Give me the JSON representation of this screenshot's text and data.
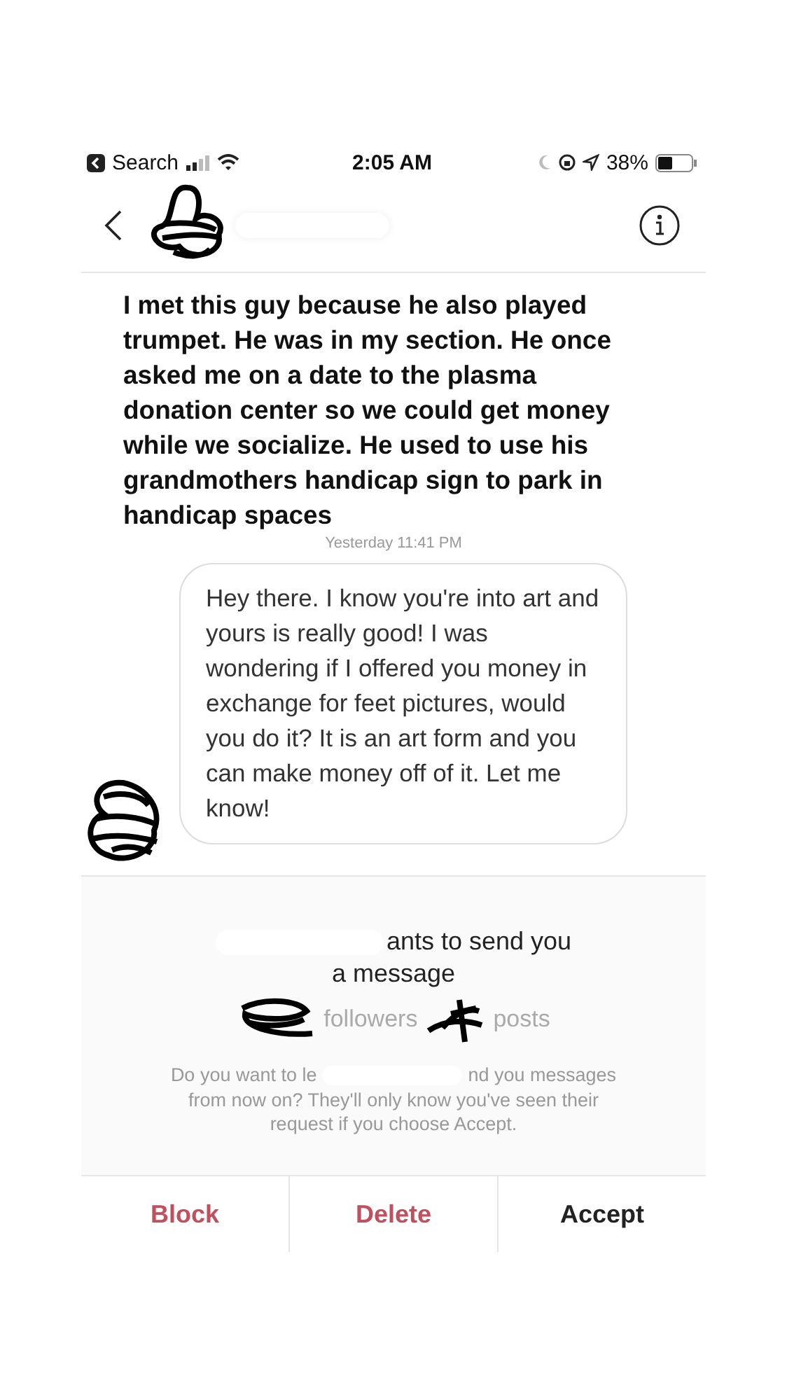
{
  "status_bar": {
    "back_app": "Search",
    "time": "2:05 AM",
    "battery": "38%"
  },
  "caption": "I met this guy because he also played trumpet. He was in my section. He once asked me on a date to the plasma donation center so we could get money while we socialize. He used to use his grandmothers handicap sign to park in handicap spaces",
  "timestamp": "Yesterday 11:41 PM",
  "message": "Hey there. I know you're into art and yours is really good! I was wondering if I offered you money in exchange for feet pictures, would you do it? It is an art form and you can make money off of it. Let me know!",
  "request": {
    "title_lines": [
      "ants to send you",
      "a message"
    ],
    "stats": [
      "followers",
      "posts"
    ],
    "prompt_parts": [
      "Do you want to le",
      "nd you messages"
    ],
    "prompt_rest": "from now on? They'll only know you've seen their request if you choose Accept."
  },
  "actions": [
    {
      "label": "Block",
      "kind": "destructive"
    },
    {
      "label": "Delete",
      "kind": "destructive"
    },
    {
      "label": "Accept",
      "kind": "primary"
    }
  ]
}
